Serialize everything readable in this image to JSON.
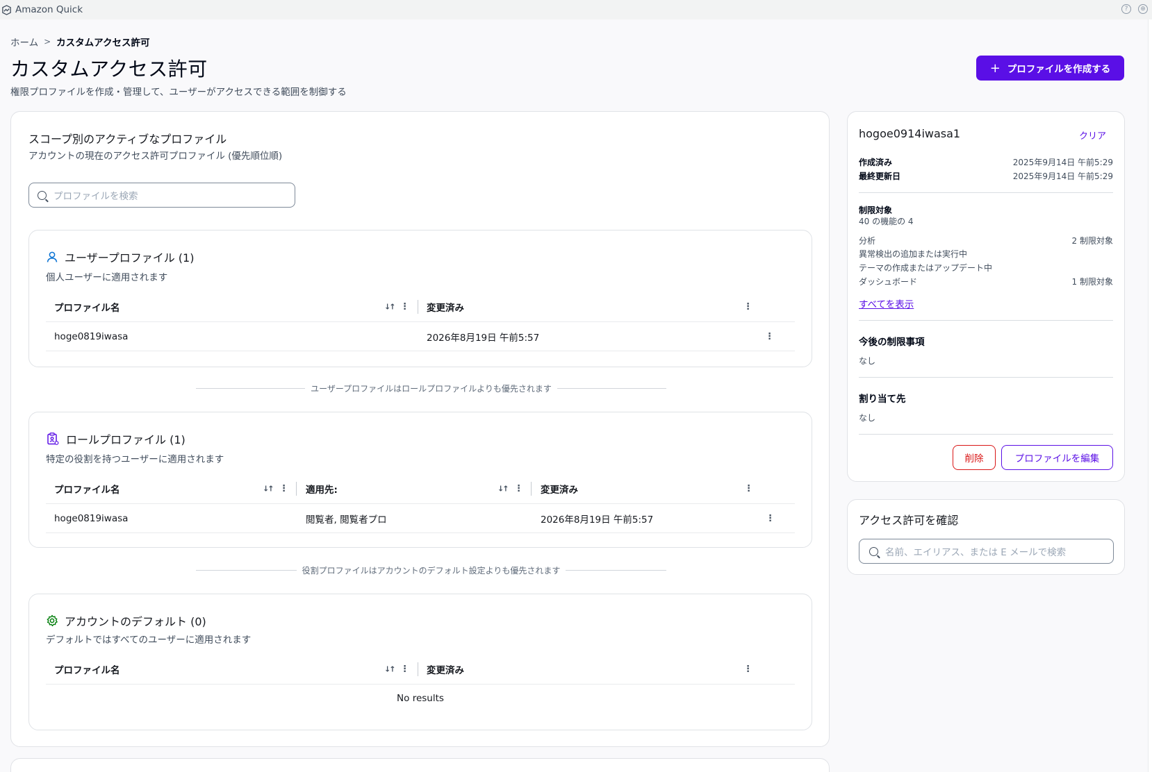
{
  "app": {
    "title": "Amazon Quick"
  },
  "breadcrumb": {
    "home": "ホーム",
    "separator": ">",
    "current": "カスタムアクセス許可"
  },
  "page": {
    "title": "カスタムアクセス許可",
    "description": "権限プロファイルを作成・管理して、ユーザーがアクセスできる範囲を制御する",
    "create_button": "プロファイルを作成する"
  },
  "profiles_panel": {
    "title": "スコープ別のアクティブなプロファイル",
    "subtitle": "アカウントの現在のアクセス許可プロファイル (優先順位順)",
    "search_placeholder": "プロファイルを検索"
  },
  "user_profiles": {
    "title": "ユーザープロファイル (1)",
    "subtitle": "個人ユーザーに適用されます",
    "columns": [
      "プロファイル名",
      "変更済み"
    ],
    "rows": [
      {
        "name": "hoge0819iwasa",
        "modified": "2026年8月19日 午前5:57"
      }
    ]
  },
  "note_user_over_role": "ユーザープロファイルはロールプロファイルよりも優先されます",
  "role_profiles": {
    "title": "ロールプロファイル (1)",
    "subtitle": "特定の役割を持つユーザーに適用されます",
    "columns": [
      "プロファイル名",
      "適用先:",
      "変更済み"
    ],
    "rows": [
      {
        "name": "hoge0819iwasa",
        "applies_to": "閲覧者, 閲覧者プロ",
        "modified": "2026年8月19日 午前5:57"
      }
    ]
  },
  "note_role_over_default": "役割プロファイルはアカウントのデフォルト設定よりも優先されます",
  "account_defaults": {
    "title": "アカウントのデフォルト (0)",
    "subtitle": "デフォルトではすべてのユーザーに適用されます",
    "columns": [
      "プロファイル名",
      "変更済み"
    ],
    "empty_text": "No results"
  },
  "detail": {
    "name": "hogoe0914iwasa1",
    "clear": "クリア",
    "created_label": "作成済み",
    "created_value": "2025年9月14日 午前5:29",
    "updated_label": "最終更新日",
    "updated_value": "2025年9月14日 午前5:29",
    "restricted_label": "制限対象",
    "restricted_count": "40 の機能の 4",
    "analysis_label": "分析",
    "analysis_count": "2 制限対象",
    "analysis_items": [
      "異常検出の追加または実行中",
      "テーマの作成またはアップデート中"
    ],
    "dashboard_label": "ダッシュボード",
    "dashboard_count": "1 制限対象",
    "show_all": "すべてを表示",
    "future_label": "今後の制限事項",
    "future_value": "なし",
    "assigned_label": "割り当て先",
    "assigned_value": "なし",
    "delete_button": "削除",
    "edit_button": "プロファイルを編集"
  },
  "check_access": {
    "title": "アクセス許可を確認",
    "placeholder": "名前、エイリアス、または E メールで検索"
  },
  "colors": {
    "accent": "#5a0fe6",
    "danger": "#d91515",
    "user_icon": "#0972d3",
    "role_icon": "#5a0fe6",
    "default_icon": "#037f0c"
  },
  "icons": [
    "quick-logo-icon",
    "help-icon",
    "globe-icon",
    "plus-icon",
    "search-icon",
    "user-icon",
    "clipboard-user-icon",
    "gear-icon",
    "sort-icon",
    "kebab-icon"
  ]
}
